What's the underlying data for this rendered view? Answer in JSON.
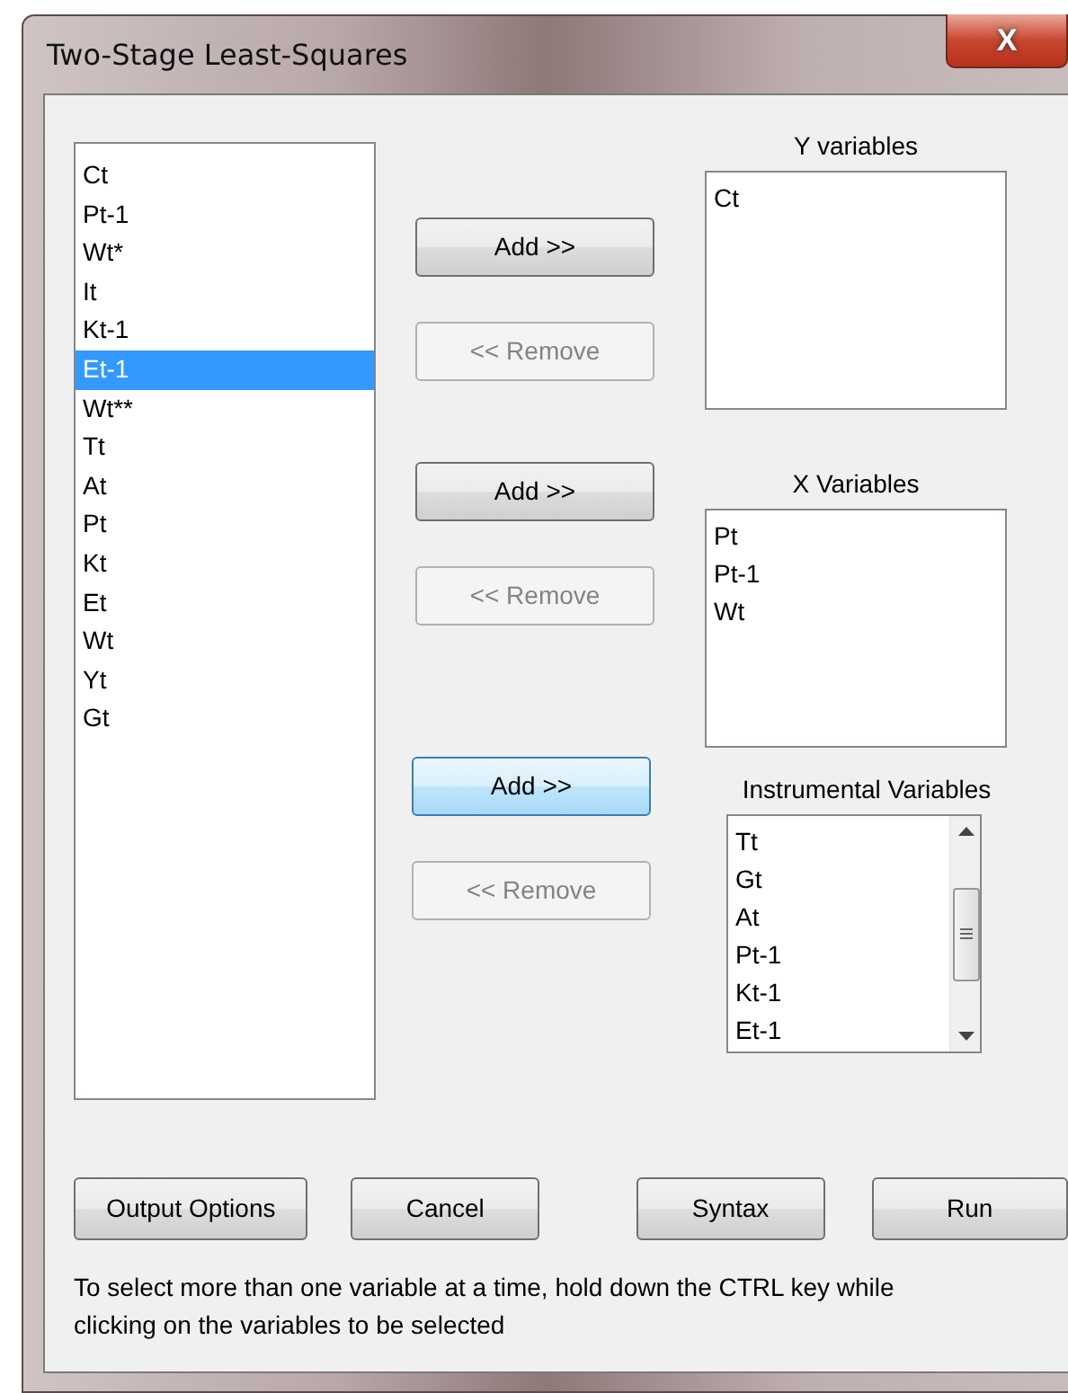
{
  "window": {
    "title": "Two-Stage Least-Squares",
    "close": "X"
  },
  "variables": {
    "items": [
      {
        "label": "Ct",
        "selected": false
      },
      {
        "label": "Pt-1",
        "selected": false
      },
      {
        "label": "Wt*",
        "selected": false
      },
      {
        "label": "It",
        "selected": false
      },
      {
        "label": "Kt-1",
        "selected": false
      },
      {
        "label": "Et-1",
        "selected": true
      },
      {
        "label": "Wt**",
        "selected": false
      },
      {
        "label": "Tt",
        "selected": false
      },
      {
        "label": "At",
        "selected": false
      },
      {
        "label": "Pt",
        "selected": false
      },
      {
        "label": "Kt",
        "selected": false
      },
      {
        "label": "Et",
        "selected": false
      },
      {
        "label": "Wt",
        "selected": false
      },
      {
        "label": "Yt",
        "selected": false
      },
      {
        "label": "Gt",
        "selected": false
      }
    ]
  },
  "sections": [
    {
      "label": "Y variables",
      "add": {
        "label": "Add >>",
        "focused": false,
        "disabled": false
      },
      "remove": {
        "label": "<< Remove",
        "disabled": true
      },
      "scrollbar": false,
      "items": [
        "Ct"
      ]
    },
    {
      "label": "X Variables",
      "add": {
        "label": "Add >>",
        "focused": false,
        "disabled": false
      },
      "remove": {
        "label": "<< Remove",
        "disabled": true
      },
      "scrollbar": false,
      "items": [
        "Pt",
        "Pt-1",
        "Wt"
      ]
    },
    {
      "label": "Instrumental Variables",
      "add": {
        "label": "Add >>",
        "focused": true,
        "disabled": false
      },
      "remove": {
        "label": "<< Remove",
        "disabled": true
      },
      "scrollbar": true,
      "items": [
        "Tt",
        "Gt",
        "At",
        "Pt-1",
        "Kt-1",
        "Et-1"
      ]
    }
  ],
  "buttons": [
    "Output Options",
    "Cancel",
    "Syntax",
    "Run"
  ],
  "note": "To select more than one variable at a time, hold down the CTRL key while clicking on the variables to be selected"
}
